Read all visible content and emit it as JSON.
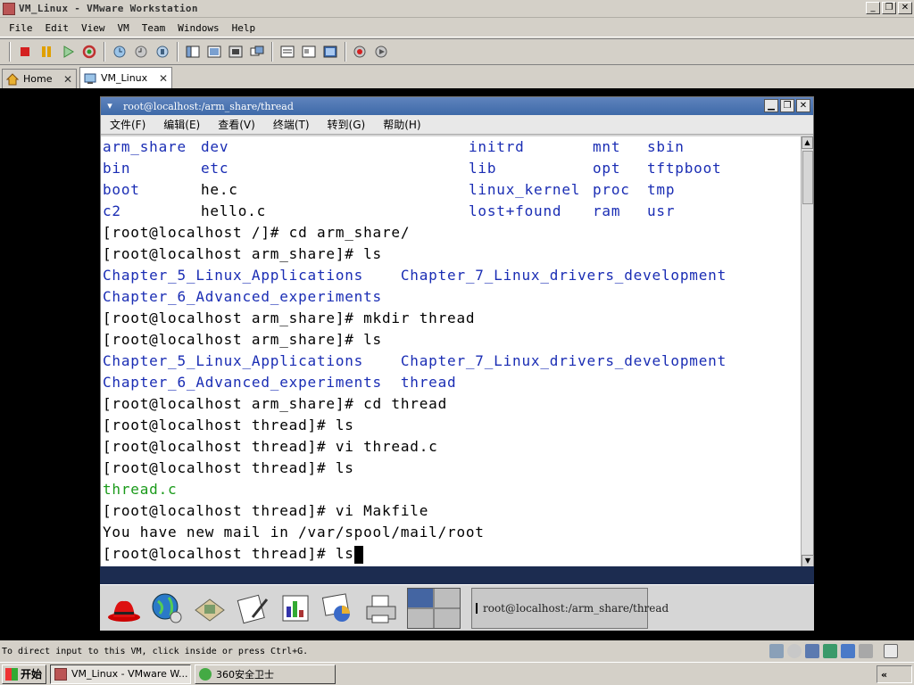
{
  "window": {
    "title": "VM_Linux - VMware Workstation"
  },
  "menu": [
    "File",
    "Edit",
    "View",
    "VM",
    "Team",
    "Windows",
    "Help"
  ],
  "tabs": [
    {
      "label": "Home",
      "active": false
    },
    {
      "label": "VM_Linux",
      "active": true
    }
  ],
  "guest": {
    "window_title": "root@localhost:/arm_share/thread",
    "menu": [
      "文件(F)",
      "编辑(E)",
      "查看(V)",
      "终端(T)",
      "转到(G)",
      "帮助(H)"
    ],
    "ls_root": [
      [
        "arm_share",
        "dev",
        "initrd",
        "mnt",
        "sbin"
      ],
      [
        "bin",
        "etc",
        "lib",
        "opt",
        "tftpboot"
      ],
      [
        "boot",
        "he.c",
        "linux_kernel",
        "proc",
        "tmp"
      ],
      [
        "c2",
        "hello.c",
        "lost+found",
        "ram",
        "usr"
      ]
    ],
    "terminal_lines": [
      {
        "text": "[root@localhost /]# cd arm_share/",
        "style": "plain"
      },
      {
        "text": "[root@localhost arm_share]# ls",
        "style": "plain"
      },
      {
        "text": "Chapter_5_Linux_Applications    Chapter_7_Linux_drivers_development",
        "style": "blue"
      },
      {
        "text": "Chapter_6_Advanced_experiments",
        "style": "blue"
      },
      {
        "text": "[root@localhost arm_share]# mkdir thread",
        "style": "plain"
      },
      {
        "text": "[root@localhost arm_share]# ls",
        "style": "plain"
      },
      {
        "text": "Chapter_5_Linux_Applications    Chapter_7_Linux_drivers_development",
        "style": "blue"
      },
      {
        "text": "Chapter_6_Advanced_experiments  thread",
        "style": "blue"
      },
      {
        "text": "[root@localhost arm_share]# cd thread",
        "style": "plain"
      },
      {
        "text": "[root@localhost thread]# ls",
        "style": "plain"
      },
      {
        "text": "[root@localhost thread]# vi thread.c",
        "style": "plain"
      },
      {
        "text": "[root@localhost thread]# ls",
        "style": "plain"
      },
      {
        "text": "thread.c",
        "style": "green"
      },
      {
        "text": "[root@localhost thread]# vi Makfile",
        "style": "plain"
      },
      {
        "text": "You have new mail in /var/spool/mail/root",
        "style": "plain"
      }
    ],
    "prompt_line": "[root@localhost thread]# ls",
    "panel_task": "root@localhost:/arm_share/thread"
  },
  "status_text": "To direct input to this VM, click inside or press Ctrl+G.",
  "taskbar": {
    "start_label": "开始",
    "tasks": [
      {
        "label": "VM_Linux - VMware W...",
        "pressed": true
      },
      {
        "label": "360安全卫士",
        "pressed": false
      }
    ],
    "tray_label": "«"
  },
  "colors": {
    "ls_dir": "#1a2db4",
    "ls_exec": "#1a9a1a",
    "guest_title": "#3e6aa8"
  }
}
